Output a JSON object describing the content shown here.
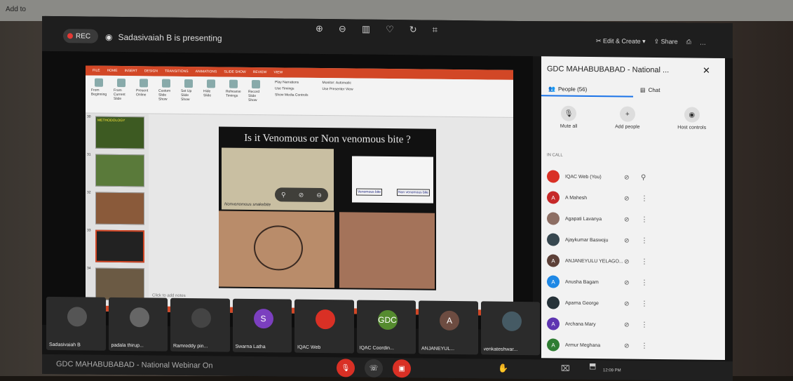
{
  "corner": {
    "label": "Add to"
  },
  "header": {
    "rec_label": "REC",
    "presenter_text": "Sadasivaiah B is presenting",
    "edit_label": "Edit & Create",
    "share_label": "Share"
  },
  "slide": {
    "title": "Is it Venomous or Non venomous bite ?",
    "nonvenomous_label": "Nonvenomous snakebite",
    "venomous_label": "Venomous bite",
    "nonvenomous_bite_label": "Non venomous bite",
    "notes_placeholder": "Click to add notes",
    "thumb_numbers": [
      "30",
      "31",
      "32",
      "33",
      "34"
    ],
    "thumb30_title": "METHODOLOGY"
  },
  "ribbon": {
    "tabs": [
      "FILE",
      "HOME",
      "INSERT",
      "DESIGN",
      "TRANSITIONS",
      "ANIMATIONS",
      "SLIDE SHOW",
      "REVIEW",
      "VIEW"
    ],
    "buttons": [
      "From Beginning",
      "From Current Slide",
      "Present Online",
      "Custom Slide Show",
      "Set Up Slide Show",
      "Hide Slide",
      "Rehearse Timings",
      "Record Slide Show"
    ],
    "checks": [
      "Play Narrations",
      "Use Timings",
      "Show Media Controls"
    ],
    "monitor_label": "Monitor:",
    "monitor_value": "Automatic",
    "presenter_view": "Use Presenter View"
  },
  "sidebar": {
    "title": "GDC MAHABUBABAD - National ...",
    "tab_people": "People (56)",
    "tab_chat": "Chat",
    "action_mute": "Mute all",
    "action_add": "Add people",
    "action_host": "Host controls",
    "incall_label": "IN CALL",
    "people": [
      {
        "name": "IQAC Web (You)",
        "initial": "",
        "color": "#d93025"
      },
      {
        "name": "A Mahesh",
        "initial": "A",
        "color": "#c62828"
      },
      {
        "name": "Agapati Lavanya",
        "initial": "",
        "color": "#8d6e63"
      },
      {
        "name": "Ajaykumar Baswoju",
        "initial": "",
        "color": "#37474f"
      },
      {
        "name": "ANJANEYULU YELAGO...",
        "initial": "A",
        "color": "#5d4037"
      },
      {
        "name": "Anusha Bagam",
        "initial": "A",
        "color": "#1e88e5"
      },
      {
        "name": "Aparna George",
        "initial": "",
        "color": "#263238"
      },
      {
        "name": "Archana Mary",
        "initial": "A",
        "color": "#5e35b1"
      },
      {
        "name": "Armur Meghana",
        "initial": "A",
        "color": "#2e7d32"
      }
    ]
  },
  "tiles": [
    {
      "name": "Sadasivaiah B",
      "initial": "",
      "color": "#555"
    },
    {
      "name": "padala thirup...",
      "initial": "",
      "color": "#666"
    },
    {
      "name": "Ramreddy pin...",
      "initial": "",
      "color": "#444"
    },
    {
      "name": "Swarna Latha",
      "initial": "S",
      "color": "#7b3fbf"
    },
    {
      "name": "IQAC Web",
      "initial": "",
      "color": "#d93025"
    },
    {
      "name": "IQAC Coordin...",
      "initial": "GDC",
      "color": "#558b2f"
    },
    {
      "name": "ANJANEYUL...",
      "initial": "A",
      "color": "#6d4c41"
    },
    {
      "name": "venkateshwar...",
      "initial": "",
      "color": "#455a64"
    }
  ],
  "bottom": {
    "meeting_name": "GDC MAHABUBABAD - National Webinar On",
    "time": "12:09 PM"
  }
}
